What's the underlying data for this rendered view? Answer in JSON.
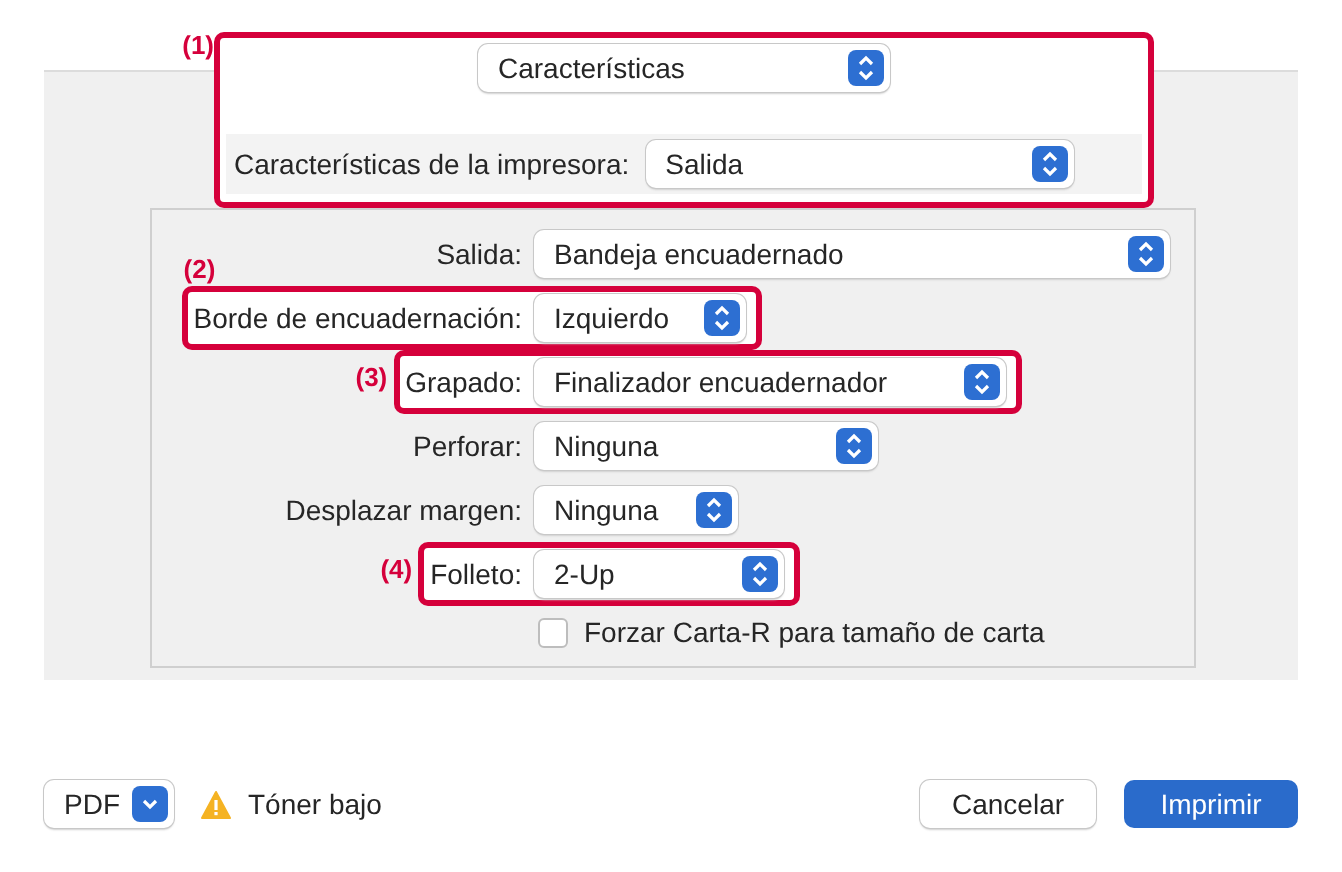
{
  "section_menu": {
    "value": "Características",
    "callout": "(1)"
  },
  "printer_features": {
    "label": "Características de la impresora:",
    "value": "Salida"
  },
  "options": [
    {
      "kind": "plain",
      "label": "Salida:",
      "value": "Bandeja encuadernado"
    },
    {
      "kind": "callout_above",
      "label": "Borde de encuadernación:",
      "value": "Izquierdo",
      "callout": "(2)"
    },
    {
      "kind": "callout_left",
      "label": "Grapado:",
      "value": "Finalizador encuadernador",
      "callout": "(3)"
    },
    {
      "kind": "plain",
      "label": "Perforar:",
      "value": "Ninguna"
    },
    {
      "kind": "plain",
      "label": "Desplazar margen:",
      "value": "Ninguna"
    },
    {
      "kind": "callout_left",
      "label": "Folleto:",
      "value": "2-Up",
      "callout": "(4)"
    }
  ],
  "checkbox": {
    "label": "Forzar Carta-R para tamaño de carta",
    "checked": false
  },
  "pdf_button": "PDF",
  "warning": "Tóner bajo",
  "buttons": [
    {
      "label": "Cancelar",
      "kind": "secondary"
    },
    {
      "label": "Imprimir",
      "kind": "primary"
    }
  ]
}
